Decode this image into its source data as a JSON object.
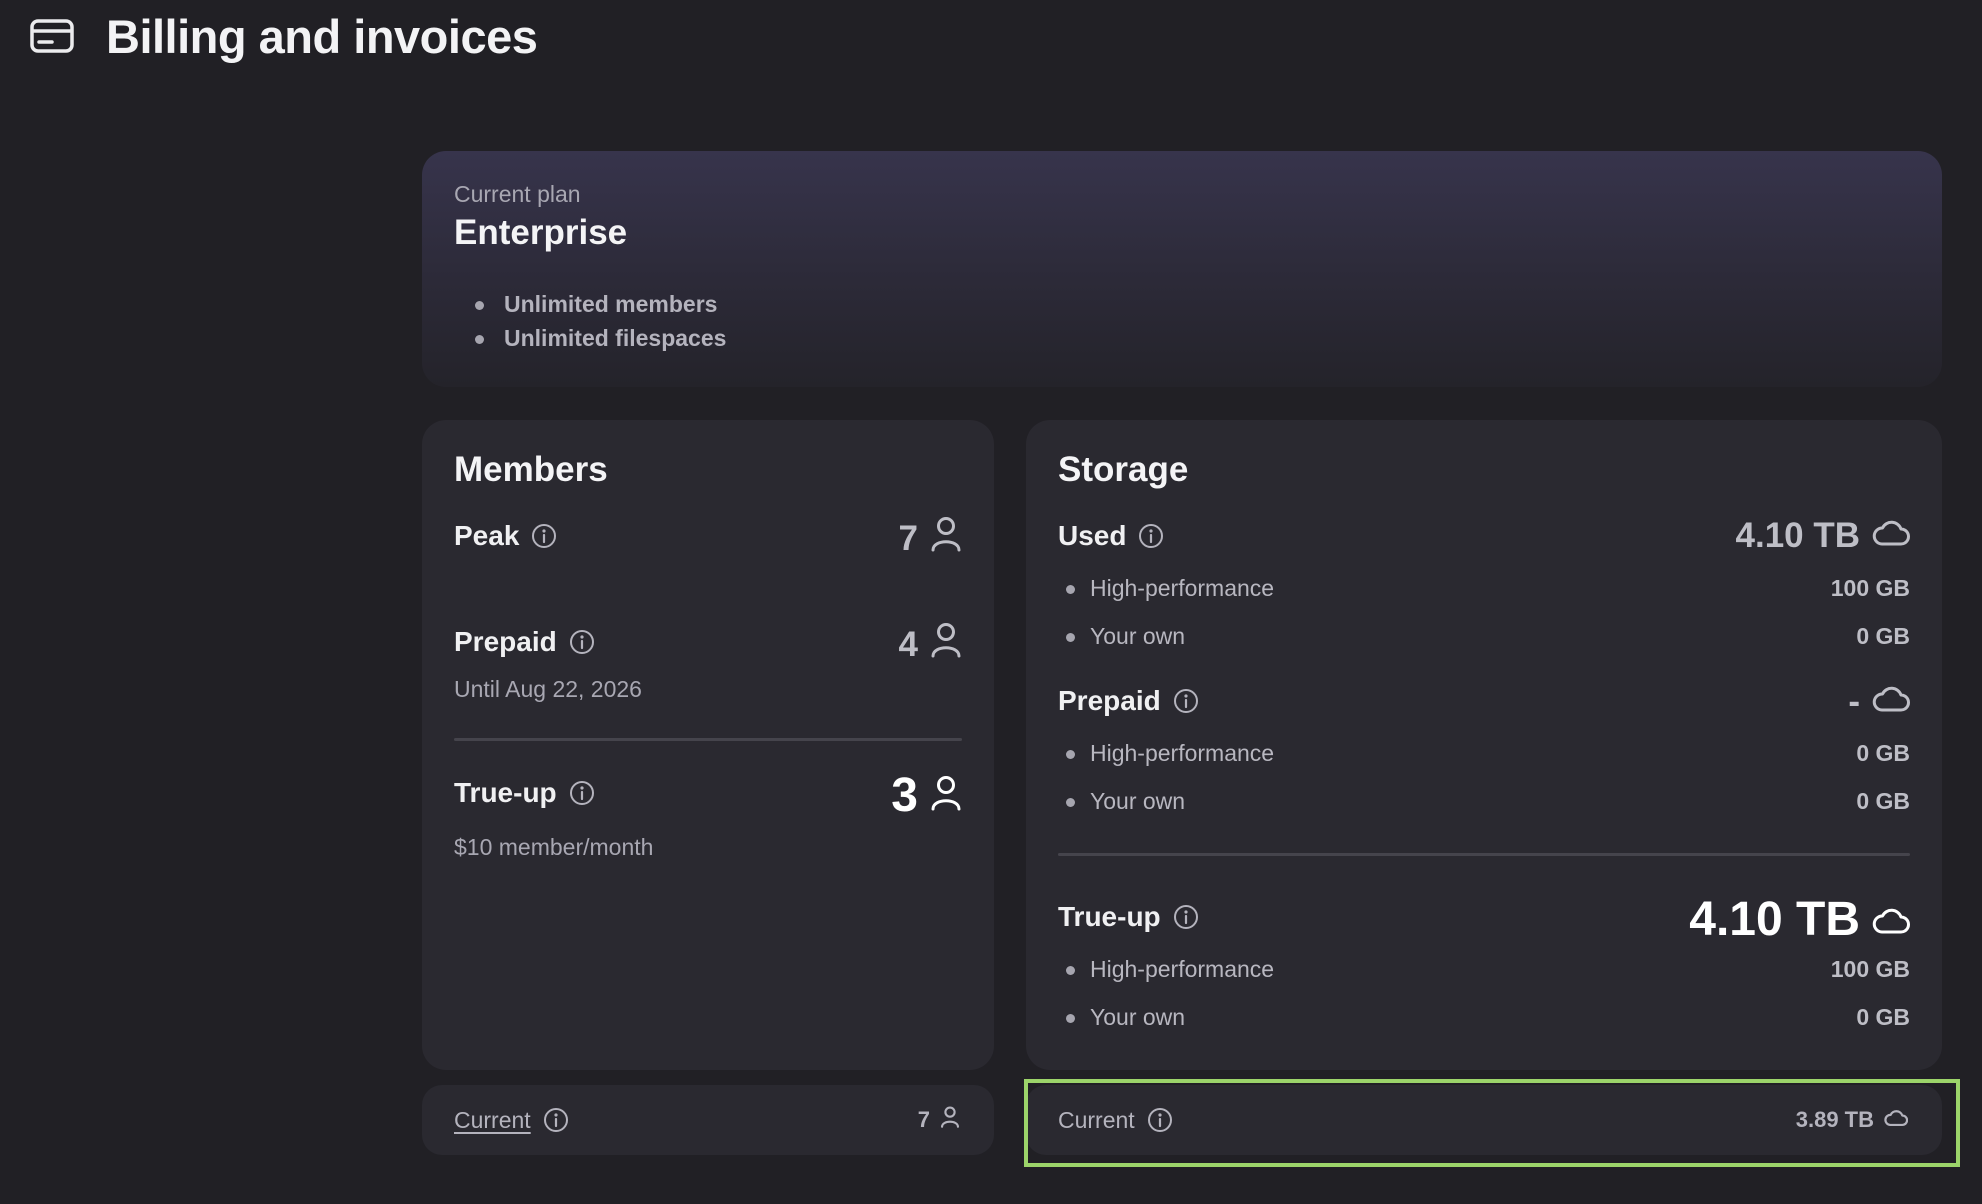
{
  "header": {
    "title": "Billing and invoices",
    "icon": "credit-card-icon"
  },
  "plan": {
    "label": "Current plan",
    "name": "Enterprise",
    "features": [
      "Unlimited members",
      "Unlimited filespaces"
    ]
  },
  "members": {
    "title": "Members",
    "peak": {
      "label": "Peak",
      "value": "7"
    },
    "prepaid": {
      "label": "Prepaid",
      "value": "4",
      "sub": "Until Aug 22, 2026"
    },
    "trueup": {
      "label": "True-up",
      "value": "3",
      "sub": "$10 member/month"
    },
    "footer": {
      "label": "Current",
      "value": "7"
    }
  },
  "storage": {
    "title": "Storage",
    "used": {
      "label": "Used",
      "value": "4.10 TB",
      "items": [
        {
          "label": "High-performance",
          "value": "100 GB"
        },
        {
          "label": "Your own",
          "value": "0 GB"
        }
      ]
    },
    "prepaid": {
      "label": "Prepaid",
      "value": "-",
      "items": [
        {
          "label": "High-performance",
          "value": "0 GB"
        },
        {
          "label": "Your own",
          "value": "0 GB"
        }
      ]
    },
    "trueup": {
      "label": "True-up",
      "value": "4.10 TB",
      "items": [
        {
          "label": "High-performance",
          "value": "100 GB"
        },
        {
          "label": "Your own",
          "value": "0 GB"
        }
      ]
    },
    "footer": {
      "label": "Current",
      "value": "3.89 TB"
    }
  },
  "colors": {
    "background": "#212025",
    "card": "#2A2930",
    "focus_ring": "#9CD46A"
  }
}
